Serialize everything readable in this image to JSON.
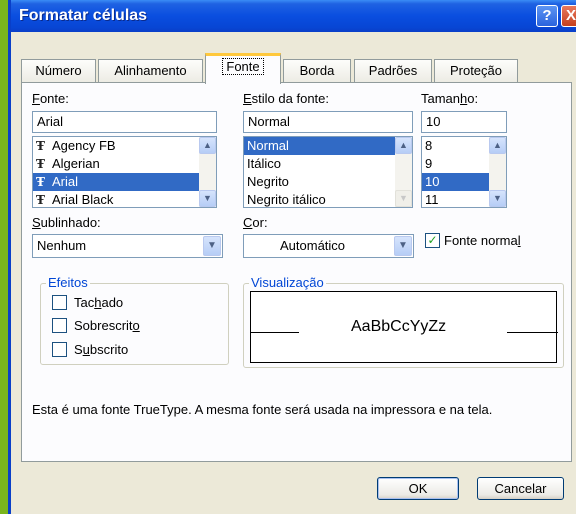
{
  "window": {
    "title": "Formatar células",
    "help_glyph": "?",
    "close_glyph": "X"
  },
  "tabs": [
    {
      "label": "Número"
    },
    {
      "label": "Alinhamento"
    },
    {
      "label": "Fonte",
      "active": true
    },
    {
      "label": "Borda"
    },
    {
      "label": "Padrões"
    },
    {
      "label": "Proteção"
    }
  ],
  "font": {
    "label_accel": "F",
    "label_rest": "onte:",
    "value": "Arial",
    "items": [
      "Agency FB",
      "Algerian",
      "Arial",
      "Arial Black"
    ],
    "selected": "Arial",
    "item_icon": "truetype-icon",
    "icon_glyph": "Ŧ"
  },
  "style": {
    "label_accel": "E",
    "label_rest": "stilo da fonte:",
    "value": "Normal",
    "items": [
      "Normal",
      "Itálico",
      "Negrito",
      "Negrito itálico"
    ],
    "selected": "Normal"
  },
  "size": {
    "label_pre": "Taman",
    "label_accel": "h",
    "label_post": "o:",
    "value": "10",
    "items": [
      "8",
      "9",
      "10",
      "11"
    ],
    "selected": "10"
  },
  "underline": {
    "label_accel": "S",
    "label_rest": "ublinhado:",
    "value": "Nenhum"
  },
  "color": {
    "label_accel": "C",
    "label_rest": "or:",
    "value": "Automático"
  },
  "normal_font": {
    "label_pre": "Fonte norma",
    "label_accel": "l",
    "checked": true,
    "check_glyph": "✓"
  },
  "effects": {
    "title": "Efeitos",
    "items": [
      {
        "pre": "Tac",
        "accel": "h",
        "post": "ado",
        "checked": false
      },
      {
        "pre": "Sobrescrit",
        "accel": "o",
        "post": "",
        "checked": false
      },
      {
        "pre": "S",
        "accel": "u",
        "post": "bscrito",
        "checked": false
      }
    ]
  },
  "preview": {
    "title": "Visualização",
    "sample": "AaBbCcYyZz"
  },
  "description": "Esta é uma fonte TrueType. A mesma fonte será usada na impressora e na tela.",
  "buttons": {
    "ok": "OK",
    "cancel": "Cancelar"
  },
  "icons": {
    "scroll_up": "▲",
    "scroll_down": "▼",
    "dropdown": "▼"
  },
  "colors": {
    "titlebar": "#0a4ee0",
    "selection": "#316ac5",
    "dialog_bg": "#ece9d8",
    "desktop": "#7ab51d",
    "active_tab_accent": "#ffc83c"
  }
}
